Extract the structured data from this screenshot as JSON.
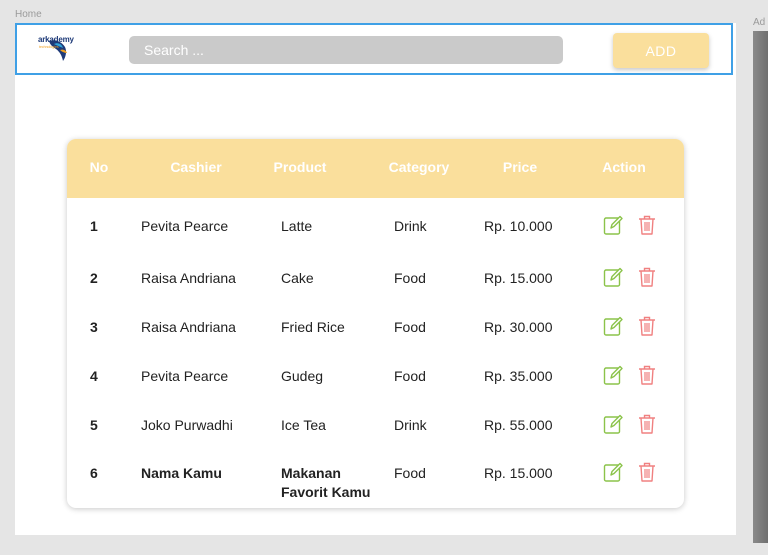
{
  "frame_labels": {
    "left": "Home",
    "right": "Ad"
  },
  "header": {
    "logo_text": "arkademy",
    "logo_sub": "technologies",
    "search_placeholder": "Search ...",
    "add_label": "ADD"
  },
  "colors": {
    "accent": "#fadf9c",
    "header_border": "#3fa0e6",
    "edit_icon": "#8bc34a",
    "delete_icon": "#f08080",
    "search_bg": "#cacaca"
  },
  "table": {
    "columns": [
      "No",
      "Cashier",
      "Product",
      "Category",
      "Price",
      "Action"
    ],
    "rows": [
      {
        "no": "1",
        "cashier": "Pevita Pearce",
        "product": "Latte",
        "product2": "",
        "category": "Drink",
        "price": "Rp. 10.000"
      },
      {
        "no": "2",
        "cashier": "Raisa Andriana",
        "product": "Cake",
        "product2": "",
        "category": "Food",
        "price": "Rp. 15.000"
      },
      {
        "no": "3",
        "cashier": "Raisa Andriana",
        "product": "Fried Rice",
        "product2": "",
        "category": "Food",
        "price": "Rp. 30.000"
      },
      {
        "no": "4",
        "cashier": "Pevita Pearce",
        "product": "Gudeg",
        "product2": "",
        "category": "Food",
        "price": "Rp. 35.000"
      },
      {
        "no": "5",
        "cashier": "Joko Purwadhi",
        "product": "Ice Tea",
        "product2": "",
        "category": "Drink",
        "price": "Rp. 55.000"
      },
      {
        "no": "6",
        "cashier": "Nama Kamu",
        "product": "Makanan",
        "product2": "Favorit Kamu",
        "category": "Food",
        "price": "Rp. 15.000"
      }
    ],
    "action_icons": [
      "edit-icon",
      "trash-icon"
    ]
  }
}
